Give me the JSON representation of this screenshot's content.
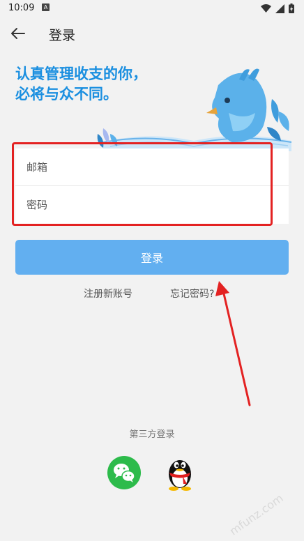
{
  "status_bar": {
    "time": "10:09",
    "notification_letter": "A"
  },
  "header": {
    "title": "登录"
  },
  "slogan": {
    "line1": "认真管理收支的你，",
    "line2": "必将与众不同。"
  },
  "form": {
    "email_placeholder": "邮箱",
    "password_placeholder": "密码"
  },
  "login_button": "登录",
  "links": {
    "register": "注册新账号",
    "forgot": "忘记密码?"
  },
  "third_party": {
    "label": "第三方登录"
  },
  "watermark": {
    "text": "mfunz.com"
  },
  "colors": {
    "accent": "#62aff0",
    "slogan": "#1a8fe0",
    "wechat": "#2dbb4b",
    "annotation": "#e32222"
  }
}
